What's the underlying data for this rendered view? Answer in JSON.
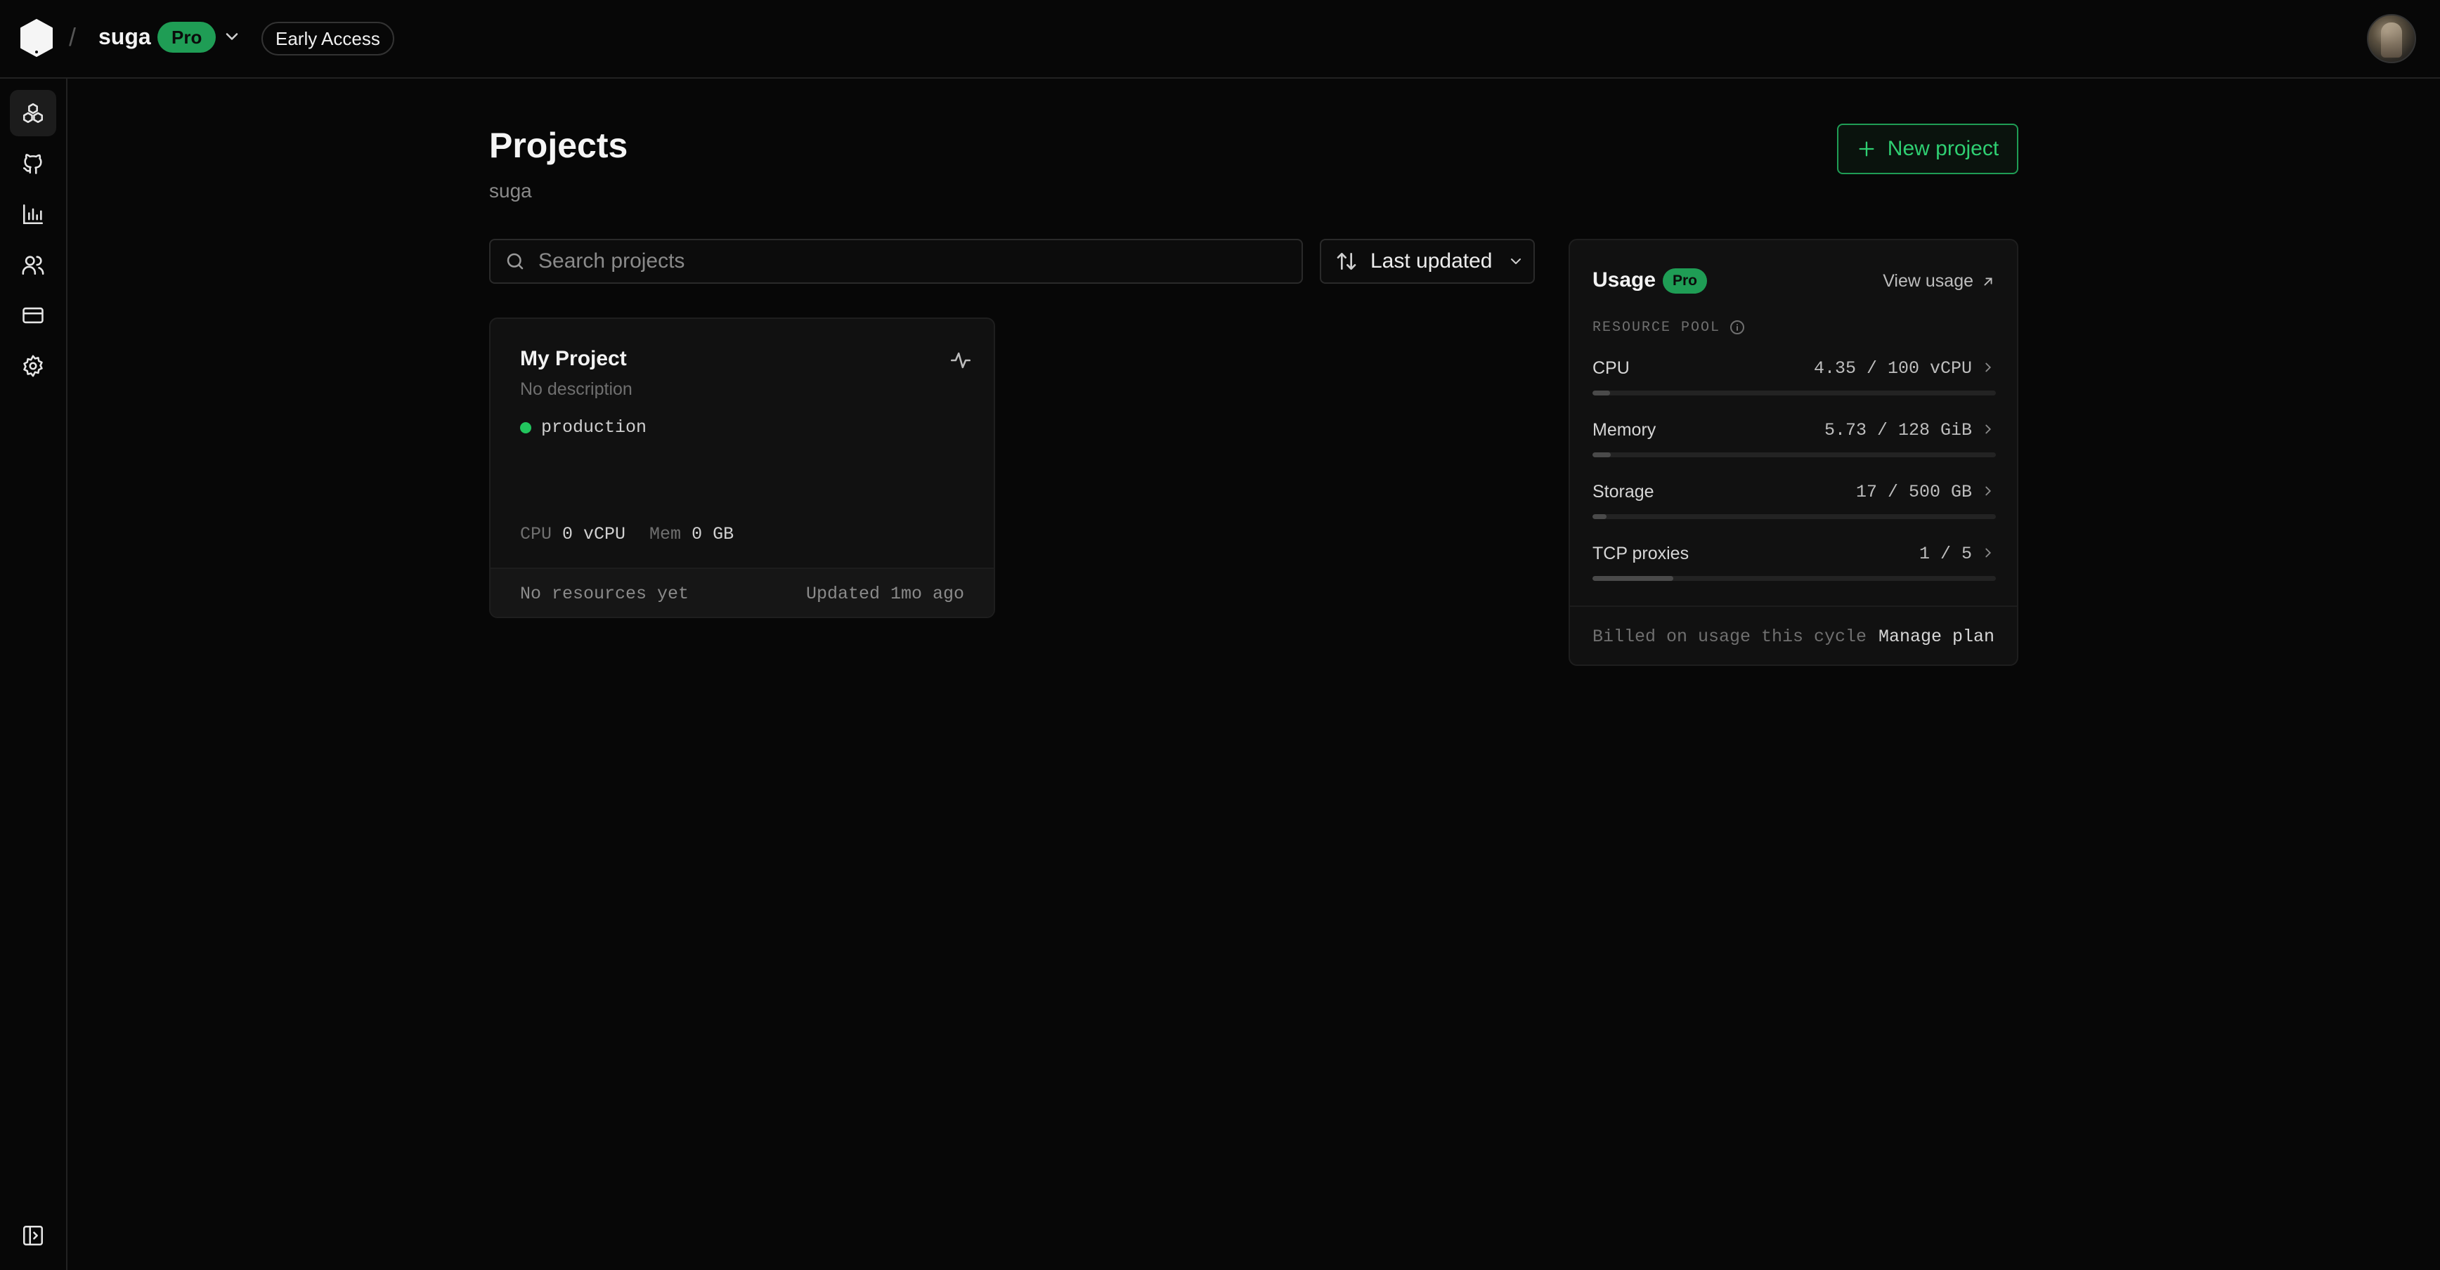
{
  "topbar": {
    "org_name": "suga",
    "plan_badge": "Pro",
    "early_access": "Early Access",
    "separator": "/"
  },
  "sidebar": {
    "items": [
      {
        "icon": "projects-icon",
        "active": true
      },
      {
        "icon": "github-icon",
        "active": false
      },
      {
        "icon": "analytics-icon",
        "active": false
      },
      {
        "icon": "team-icon",
        "active": false
      },
      {
        "icon": "billing-icon",
        "active": false
      },
      {
        "icon": "settings-icon",
        "active": false
      }
    ],
    "bottom_icon": "sidebar-toggle-icon"
  },
  "main": {
    "title": "Projects",
    "subtitle": "suga",
    "new_project_label": "New project",
    "search_placeholder": "Search projects",
    "sort_label": "Last updated"
  },
  "projects": [
    {
      "name": "My Project",
      "description": "No description",
      "environment": "production",
      "cpu_label": "CPU",
      "cpu_value": "0 vCPU",
      "mem_label": "Mem",
      "mem_value": "0 GB",
      "footer_left": "No resources yet",
      "footer_right": "Updated 1mo ago"
    }
  ],
  "usage": {
    "title": "Usage",
    "plan_badge": "Pro",
    "view_usage": "View usage",
    "pool_label": "RESOURCE POOL",
    "resources": [
      {
        "name": "CPU",
        "value": "4.35 / 100 vCPU",
        "fraction": 0.0435
      },
      {
        "name": "Memory",
        "value": "5.73 / 128 GiB",
        "fraction": 0.045
      },
      {
        "name": "Storage",
        "value": "17 / 500 GB",
        "fraction": 0.034
      },
      {
        "name": "TCP proxies",
        "value": "1 / 5",
        "fraction": 0.2
      }
    ],
    "billed_text": "Billed on usage this cycle",
    "manage_plan": "Manage plan"
  },
  "colors": {
    "accent": "#1f9d55",
    "accent_text": "#2fcf72",
    "status_green": "#22c55e",
    "background": "#070707"
  }
}
